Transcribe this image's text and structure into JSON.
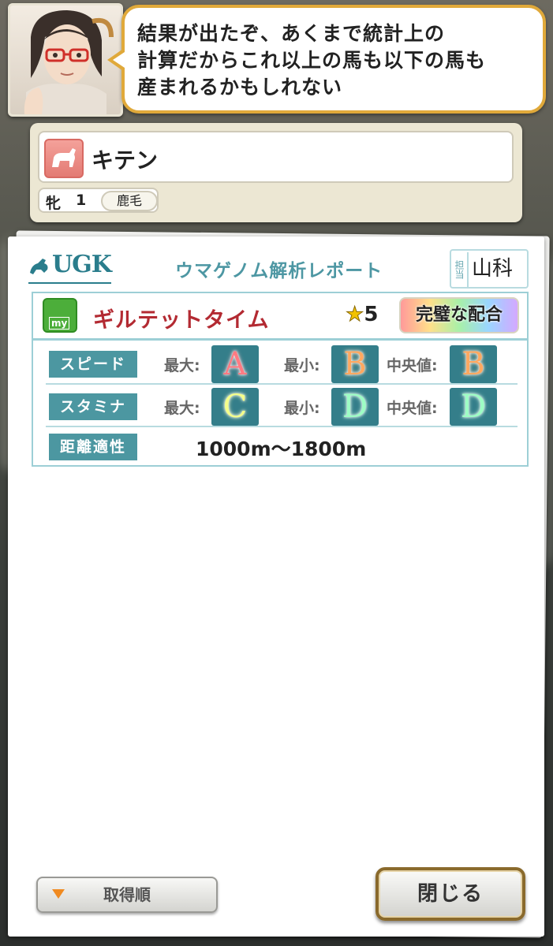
{
  "dialogue": {
    "text": "結果が出たぞ、あくまで統計上の\n計算だからこれ以上の馬も以下の馬も\n産まれるかもしれない"
  },
  "horse": {
    "name": "キテン",
    "sex": "牝",
    "age": "1",
    "coat": "鹿毛"
  },
  "report": {
    "logo": "UGK",
    "title": "ウマゲノム解析レポート",
    "stamp_label": "担当",
    "stamp_sign": "山科",
    "factor_icon": "my",
    "factor_name": "ギルテットタイム",
    "star_count": "5",
    "rating_badge": "完璧な配合",
    "max_label": "最大:",
    "min_label": "最小:",
    "median_label": "中央値:",
    "speed": {
      "label": "スピード",
      "max": "A",
      "min": "B",
      "median": "B"
    },
    "stamina": {
      "label": "スタミナ",
      "max": "C",
      "min": "D",
      "median": "D"
    },
    "distance": {
      "label": "距離適性",
      "value": "1000m〜1800m"
    }
  },
  "buttons": {
    "sort_label": "取得順",
    "close_label": "閉じる"
  },
  "colors": {
    "bubble_border": "#e0a93a",
    "factor_name": "#b32a32",
    "stat_label_bg": "#4c97a1",
    "grade_bg": "#347e8a",
    "sort_arrow": "#f08a20",
    "close_border": "#8a6a2c"
  },
  "icons": {
    "horse_silhouette": "horse-icon",
    "star": "star-icon",
    "factor": "my-factor-icon",
    "sort_arrow": "triangle-down-icon"
  }
}
